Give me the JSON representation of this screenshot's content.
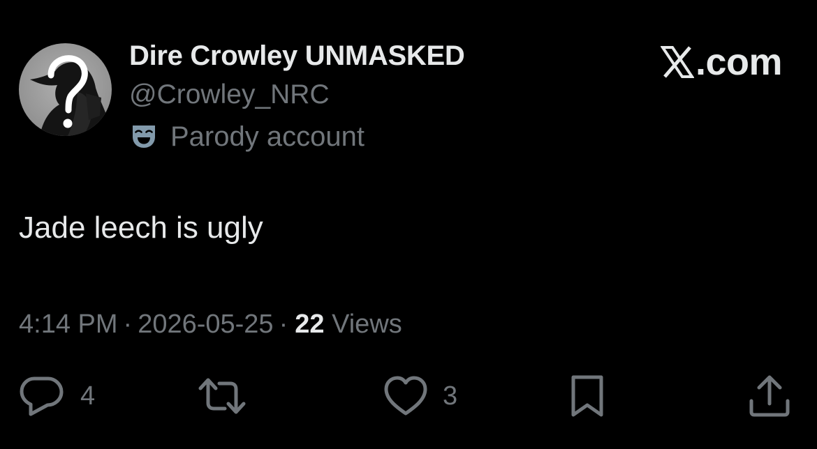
{
  "author": {
    "display_name": "Dire Crowley UNMASKED",
    "handle": "@Crowley_NRC",
    "label_icon": "theater-mask-icon",
    "label_text": "Parody account",
    "avatar_icon": "question-mark-silhouette"
  },
  "brand": {
    "icon": "x-logo-icon",
    "text": ".com"
  },
  "tweet": {
    "text": "Jade leech is ugly",
    "time": "4:14 PM",
    "separator": "·",
    "date": "2026-05-25",
    "views_count": "22",
    "views_label": "Views"
  },
  "actions": {
    "reply": {
      "icon": "reply-bubble-icon",
      "count": "4"
    },
    "retweet": {
      "icon": "retweet-icon"
    },
    "like": {
      "icon": "heart-icon",
      "count": "3"
    },
    "bookmark": {
      "icon": "bookmark-icon"
    },
    "share": {
      "icon": "share-icon"
    }
  },
  "colors": {
    "background": "#000000",
    "primary_text": "#e7e9ea",
    "secondary_text": "#71767b",
    "mask_icon": "#829aab"
  }
}
